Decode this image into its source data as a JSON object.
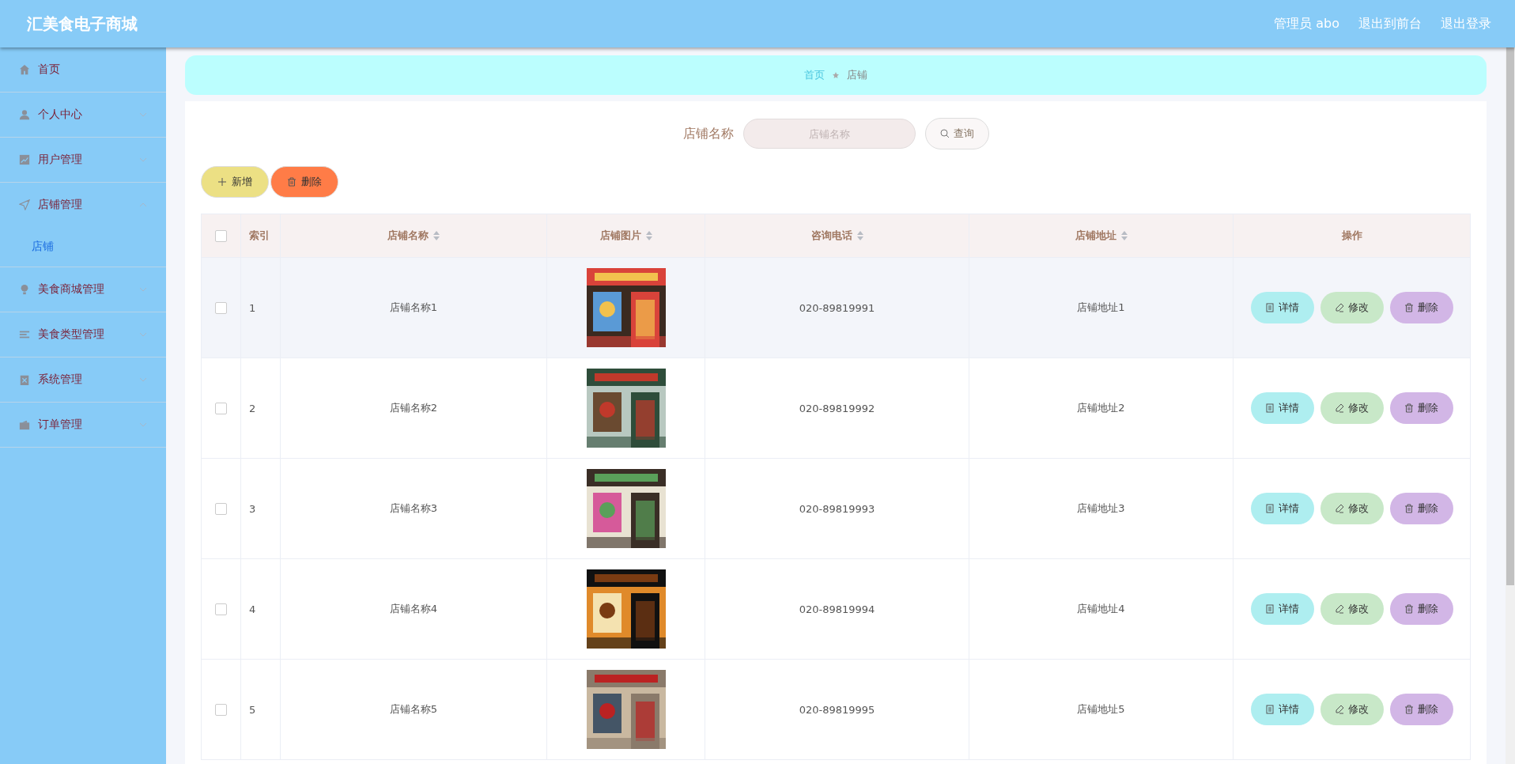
{
  "header": {
    "title": "汇美食电子商城",
    "links": [
      "管理员 abo",
      "退出到前台",
      "退出登录"
    ]
  },
  "sidebar": {
    "items": [
      {
        "label": "首页",
        "kind": "link"
      },
      {
        "label": "个人中心",
        "kind": "menu",
        "expanded": false
      },
      {
        "label": "用户管理",
        "kind": "menu",
        "expanded": false
      },
      {
        "label": "店铺管理",
        "kind": "menu",
        "expanded": true,
        "children": [
          {
            "label": "店铺",
            "selected": true
          }
        ]
      },
      {
        "label": "美食商城管理",
        "kind": "menu",
        "expanded": false
      },
      {
        "label": "美食类型管理",
        "kind": "menu",
        "expanded": false
      },
      {
        "label": "系统管理",
        "kind": "menu",
        "expanded": false
      },
      {
        "label": "订单管理",
        "kind": "menu",
        "expanded": false
      }
    ]
  },
  "breadcrumb": [
    "首页",
    "店铺"
  ],
  "search": {
    "label": "店铺名称",
    "placeholder": "店铺名称",
    "button": "查询"
  },
  "actions": [
    {
      "label": "新增",
      "kind": "add"
    },
    {
      "label": "删除",
      "kind": "delete"
    }
  ],
  "table": {
    "columns": [
      {
        "kind": "check",
        "checked": false
      },
      {
        "label": "索引",
        "kind": "text",
        "sortable": false
      },
      {
        "label": "店铺名称",
        "kind": "text",
        "sortable": true
      },
      {
        "label": "店铺图片",
        "kind": "text",
        "sortable": true
      },
      {
        "label": "咨询电话",
        "kind": "text",
        "sortable": true
      },
      {
        "label": "店铺地址",
        "kind": "text",
        "sortable": true
      },
      {
        "label": "操作",
        "kind": "text",
        "sortable": false
      }
    ],
    "rows": [
      {
        "checked": false,
        "highlighted": true,
        "index": "1",
        "name": "店铺名称1",
        "phone": "020-89819991",
        "address": "店铺地址1",
        "actions": [
          {
            "label": "详情",
            "kind": "detail"
          },
          {
            "label": "修改",
            "kind": "edit"
          },
          {
            "label": "删除",
            "kind": "delete"
          }
        ]
      },
      {
        "checked": false,
        "highlighted": false,
        "index": "2",
        "name": "店铺名称2",
        "phone": "020-89819992",
        "address": "店铺地址2",
        "actions": [
          {
            "label": "详情",
            "kind": "detail"
          },
          {
            "label": "修改",
            "kind": "edit"
          },
          {
            "label": "删除",
            "kind": "delete"
          }
        ]
      },
      {
        "checked": false,
        "highlighted": false,
        "index": "3",
        "name": "店铺名称3",
        "phone": "020-89819993",
        "address": "店铺地址3",
        "actions": [
          {
            "label": "详情",
            "kind": "detail"
          },
          {
            "label": "修改",
            "kind": "edit"
          },
          {
            "label": "删除",
            "kind": "delete"
          }
        ]
      },
      {
        "checked": false,
        "highlighted": false,
        "index": "4",
        "name": "店铺名称4",
        "phone": "020-89819994",
        "address": "店铺地址4",
        "actions": [
          {
            "label": "详情",
            "kind": "detail"
          },
          {
            "label": "修改",
            "kind": "edit"
          },
          {
            "label": "删除",
            "kind": "delete"
          }
        ]
      },
      {
        "checked": false,
        "highlighted": false,
        "index": "5",
        "name": "店铺名称5",
        "phone": "020-89819995",
        "address": "店铺地址5",
        "actions": [
          {
            "label": "详情",
            "kind": "detail"
          },
          {
            "label": "修改",
            "kind": "edit"
          },
          {
            "label": "删除",
            "kind": "delete"
          }
        ]
      }
    ]
  }
}
